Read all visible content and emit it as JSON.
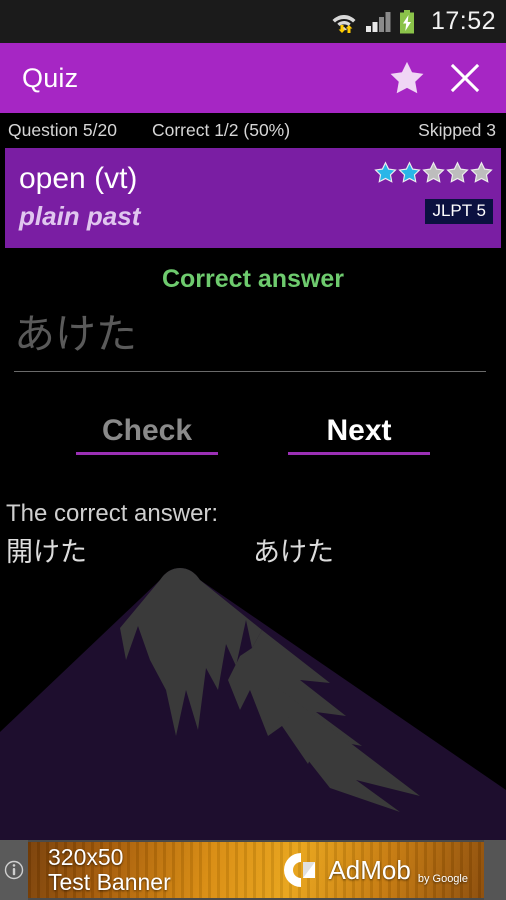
{
  "status_bar": {
    "time": "17:52",
    "icons": [
      "wifi-transfer-icon",
      "signal-icon",
      "battery-charging-icon"
    ]
  },
  "action_bar": {
    "title": "Quiz",
    "star_icon": "star-icon",
    "close_icon": "close-icon",
    "background_color": "#a626c4"
  },
  "stats": {
    "question": "Question 5/20",
    "correct": "Correct 1/2 (50%)",
    "skipped": "Skipped 3"
  },
  "question_card": {
    "term": "open (vt)",
    "form": "plain past",
    "level_badge": "JLPT 5",
    "stars_total": 5,
    "stars_filled": 2,
    "star_filled_color": "#29b6e8",
    "star_empty_color": "#bdbdbd",
    "card_color": "#7a1ea3"
  },
  "feedback": {
    "text": "Correct answer",
    "color": "#6ecb6e"
  },
  "answer_input": {
    "value": "あけた",
    "placeholder": "あけた"
  },
  "buttons": {
    "check": "Check",
    "next": "Next",
    "underline_color": "#9b30b5"
  },
  "correct_answer": {
    "label": "The correct answer:",
    "written": "開けた",
    "reading": "あけた"
  },
  "background": {
    "watermark": "mount-fuji-silhouette",
    "mountain_color": "#1e0e2e",
    "snow_color": "#3a3a3a"
  },
  "ad_banner": {
    "line1": "320x50",
    "line2": "Test Banner",
    "brand": "AdMob",
    "byline": "by Google",
    "info_icon": "info-icon"
  }
}
